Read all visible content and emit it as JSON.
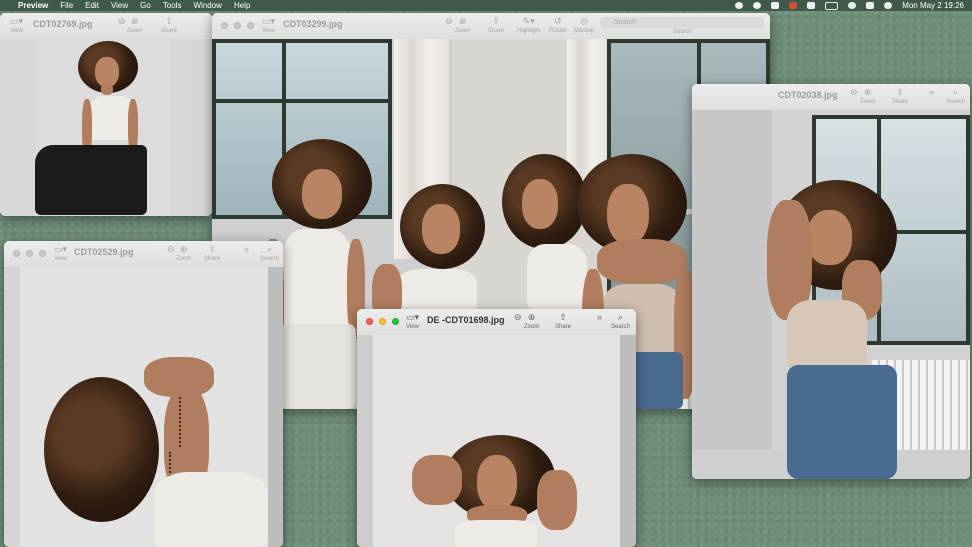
{
  "menubar": {
    "app": "Preview",
    "menus": [
      "File",
      "Edit",
      "View",
      "Go",
      "Tools",
      "Window",
      "Help"
    ],
    "clock": "Mon May 2  19:26"
  },
  "toolbar": {
    "view": "View",
    "zoom": "Zoom",
    "share": "Share",
    "highlight": "Highlight",
    "rotate": "Rotate",
    "markup": "Markup",
    "search": "Search",
    "more": "»"
  },
  "windows": {
    "w1": {
      "title": "CDT02769.jpg"
    },
    "w2": {
      "title": "CDT03299.jpg"
    },
    "w3": {
      "title": "CDT02038.jpg"
    },
    "w4": {
      "title": "CDT02529.jpg"
    },
    "w5": {
      "title": "DE -CDT01698.jpg"
    }
  },
  "colors": {
    "desktop": "#6e8e77",
    "menubar": "#3f5a4a",
    "close": "#ff5f57",
    "minimize": "#febc2e",
    "zoom": "#28c840"
  }
}
